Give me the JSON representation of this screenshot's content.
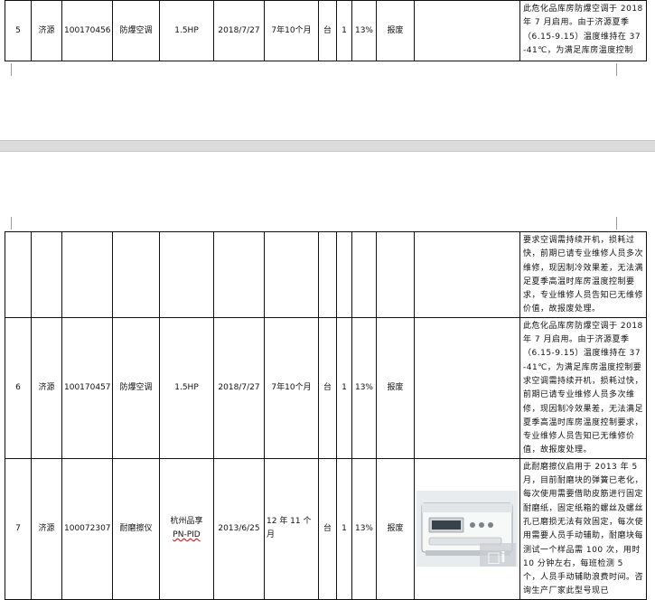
{
  "rows": [
    {
      "no": "5",
      "location": "济源",
      "asset_id": "100170456",
      "name": "防爆空调",
      "model": "1.5HP",
      "date": "2018/7/27",
      "duration": "7年10个月",
      "unit": "台",
      "qty": "1",
      "rate": "13%",
      "action": "报废",
      "note": "此危化品库房防爆空调于 2018 年 7 月启用。由于济源夏季（6.15-9.15）温度维持在 37-41℃，为满足库房温度控制"
    },
    {
      "no": "",
      "location": "",
      "asset_id": "",
      "name": "",
      "model": "",
      "date": "",
      "duration": "",
      "unit": "",
      "qty": "",
      "rate": "",
      "action": "",
      "note": "要求空调需持续开机，损耗过快，前期已请专业维修人员多次维修，现因制冷效果差，无法满足夏季高温时库房温度控制要求，专业维修人员告知已无维修价值，故报废处理。"
    },
    {
      "no": "6",
      "location": "济源",
      "asset_id": "100170457",
      "name": "防爆空调",
      "model": "1.5HP",
      "date": "2018/7/27",
      "duration": "7年10个月",
      "unit": "台",
      "qty": "1",
      "rate": "13%",
      "action": "报废",
      "note": "此危化品库房防爆空调于 2018 年 7 月启用。由于济源夏季（6.15-9.15）温度维持在 37-41℃，为满足库房温度控制要求空调需持续开机，损耗过快，前期已请专业维修人员多次维修，现因制冷效果差，无法满足夏季高温时库房温度控制要求，专业维修人员告知已无维修价值，故报废处理。"
    },
    {
      "no": "7",
      "location": "济源",
      "asset_id": "100072307",
      "name": "耐磨擦仪",
      "model_line1": "杭州品享",
      "model_line2": "PN-PID",
      "date": "2013/6/25",
      "duration": "12 年 11 个月",
      "unit": "台",
      "qty": "1",
      "rate": "13%",
      "action": "报废",
      "note": "此耐磨擦仪启用于 2013 年 5 月，目前耐磨块的弹簧已老化，每次使用需要借助皮筋进行固定耐磨纸，固定纸箱的螺丝及螺丝孔已磨损无法有效固定，每次使用需要人员手动辅助，耐磨块每测试一个样品需 100 次，用时 10 分钟左右，每班检测 5 个，人员手动辅助浪费时间。咨询生产厂家此型号现已"
    }
  ]
}
